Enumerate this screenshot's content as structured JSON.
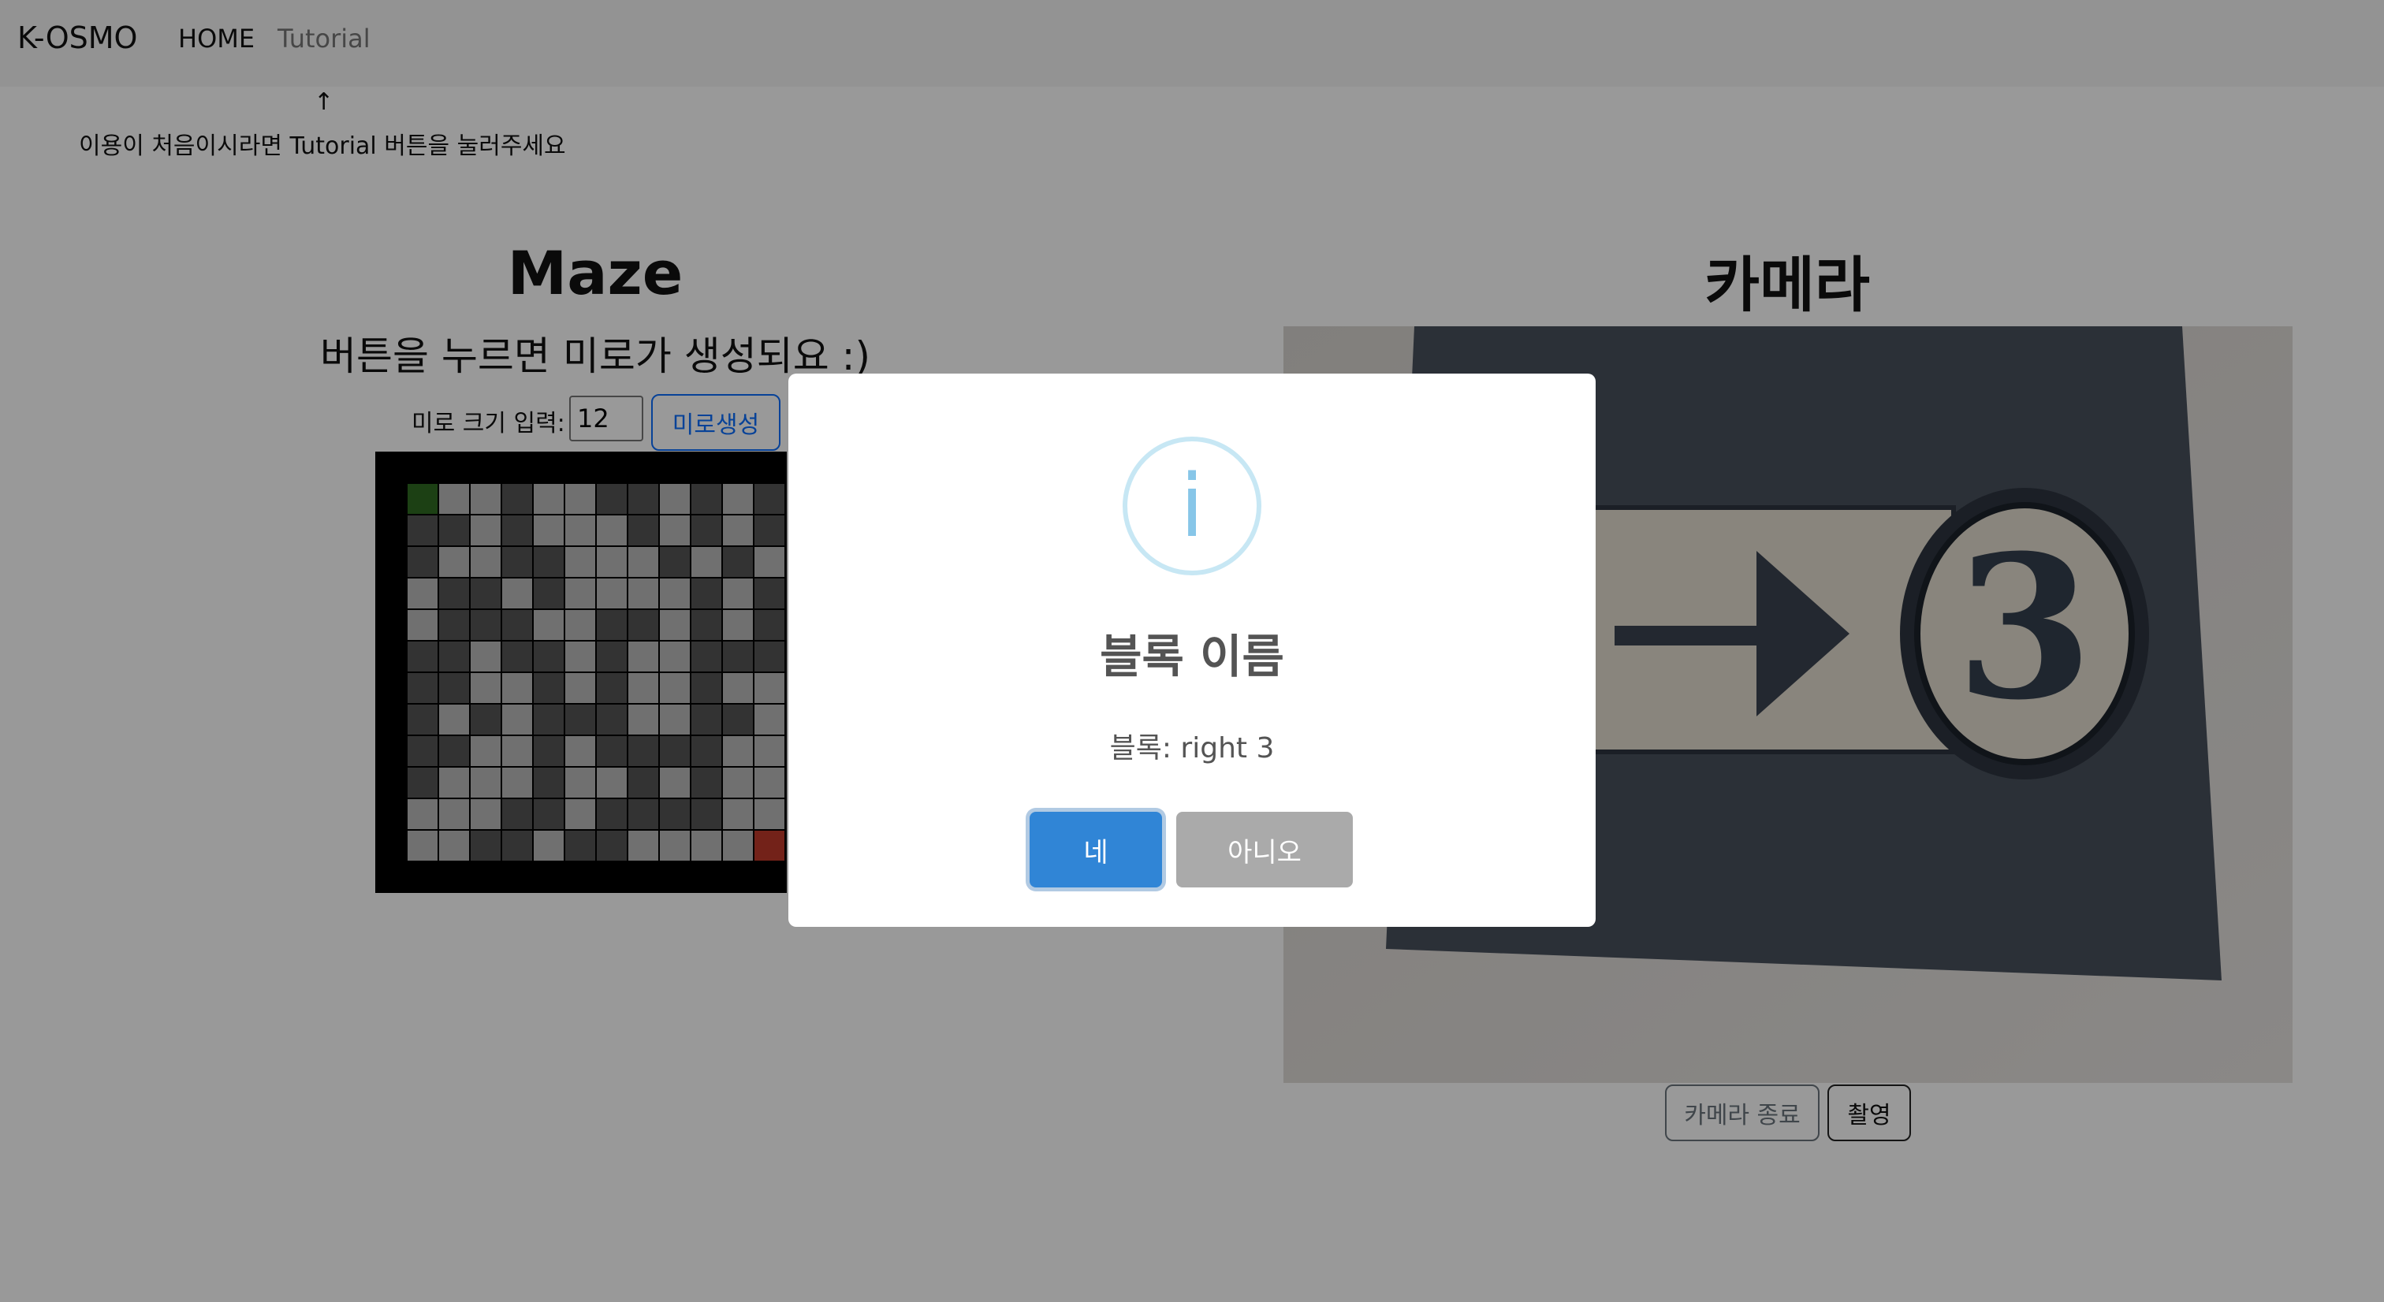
{
  "navbar": {
    "brand": "K-OSMO",
    "home": "HOME",
    "tutorial": "Tutorial"
  },
  "hint": {
    "arrow": "↑",
    "text": "이용이 처음이시라면 Tutorial 버튼을 눌러주세요"
  },
  "maze": {
    "title": "Maze",
    "subtitle": "버튼을 누르면 미로가 생성되요 :)",
    "size_label": "미로 크기 입력:",
    "size_value": "12",
    "generate_button": "미로생성",
    "grid": [
      "SLLDLLDDLDLD",
      "DDLDLLLDLDLD",
      "DLLDDLLLDLDL",
      "LDDLDLLLLDLD",
      "LDDDLLDDLDLD",
      "DDLDDLDLLDDD",
      "DDLLDLDLLDLL",
      "DLDLDDDLLDDL",
      "DDLLDLDDDDLL",
      "DLLLDLLDLDLL",
      "LLLDDLDDDDLL",
      "LLDDLDDLLLLE"
    ],
    "colors": {
      "wall": "#555555",
      "path": "#bbbbbb",
      "start": "#2f6b22",
      "end": "#c0392b"
    }
  },
  "camera": {
    "title": "카메라",
    "block_number": "3",
    "stop_button": "카메라 종료",
    "capture_button": "촬영"
  },
  "modal": {
    "icon": "info-icon",
    "icon_glyph": "i",
    "title": "블록 이름",
    "text": "블록: right 3",
    "confirm": "네",
    "cancel": "아니오"
  }
}
